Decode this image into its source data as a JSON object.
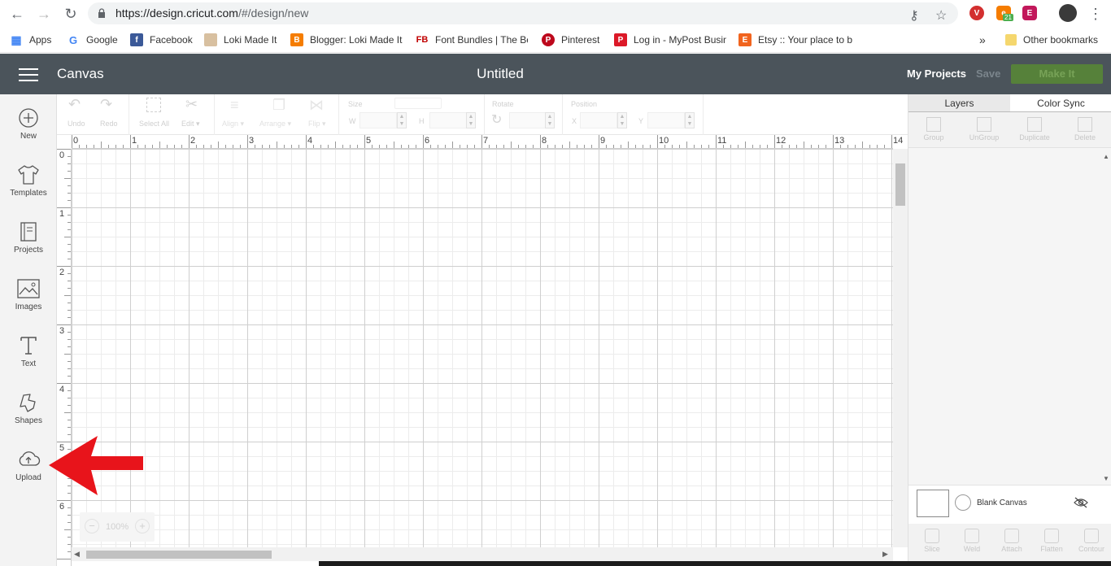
{
  "browser": {
    "url_host": "https://design.cricut.com",
    "url_path": "/#/design/new",
    "bookmarks": [
      {
        "label": "Apps",
        "icon": "apps-grid-icon",
        "color": "#4285f4"
      },
      {
        "label": "Google",
        "icon": "google-icon",
        "color": "#4285f4"
      },
      {
        "label": "Facebook",
        "icon": "facebook-icon",
        "color": "#3b5998"
      },
      {
        "label": "Loki Made It",
        "icon": "loki-icon",
        "color": "#c9a27a"
      },
      {
        "label": "Blogger: Loki Made It",
        "icon": "blogger-icon",
        "color": "#f57d00"
      },
      {
        "label": "Font Bundles | The Be",
        "icon": "fontbundles-icon",
        "color": "#c00000"
      },
      {
        "label": "Pinterest",
        "icon": "pinterest-icon",
        "color": "#bd081c"
      },
      {
        "label": "Log in - MyPost Busin",
        "icon": "mypost-icon",
        "color": "#dc1928"
      },
      {
        "label": "Etsy :: Your place to b",
        "icon": "etsy-icon",
        "color": "#f1641e"
      }
    ],
    "overflow_label": "»",
    "other_bookmarks": "Other bookmarks",
    "ext_badge": "21"
  },
  "header": {
    "app_name": "Canvas",
    "doc_title": "Untitled",
    "my_projects": "My Projects",
    "save": "Save",
    "make_it": "Make It"
  },
  "sidebar": {
    "items": [
      {
        "label": "New",
        "icon": "plus-circle-icon"
      },
      {
        "label": "Templates",
        "icon": "tshirt-icon"
      },
      {
        "label": "Projects",
        "icon": "projects-icon"
      },
      {
        "label": "Images",
        "icon": "image-icon"
      },
      {
        "label": "Text",
        "icon": "text-icon"
      },
      {
        "label": "Shapes",
        "icon": "shapes-icon"
      },
      {
        "label": "Upload",
        "icon": "upload-cloud-icon"
      }
    ]
  },
  "toolbar": {
    "undo": "Undo",
    "redo": "Redo",
    "select_all": "Select All",
    "edit": "Edit",
    "align": "Align",
    "arrange": "Arrange",
    "flip": "Flip",
    "size": "Size",
    "w": "W",
    "h": "H",
    "rotate": "Rotate",
    "position": "Position",
    "x": "X",
    "y": "Y"
  },
  "canvas": {
    "ruler_top": [
      "0",
      "1",
      "2",
      "3",
      "4",
      "5",
      "6",
      "7",
      "8",
      "9",
      "10",
      "11",
      "12",
      "13",
      "14"
    ],
    "ruler_left": [
      "0",
      "1",
      "2",
      "3",
      "4",
      "5",
      "6"
    ],
    "zoom": "100%",
    "zoom_minus": "−",
    "zoom_plus": "+"
  },
  "right_panel": {
    "tabs": [
      "Layers",
      "Color Sync"
    ],
    "tools": [
      "Group",
      "UnGroup",
      "Duplicate",
      "Delete"
    ],
    "blank_canvas": "Blank Canvas",
    "bottom_tools": [
      "Slice",
      "Weld",
      "Attach",
      "Flatten",
      "Contour"
    ]
  },
  "colors": {
    "header_bg": "#4b545b",
    "make_it_bg": "#56813a",
    "arrow": "#e8141b"
  }
}
